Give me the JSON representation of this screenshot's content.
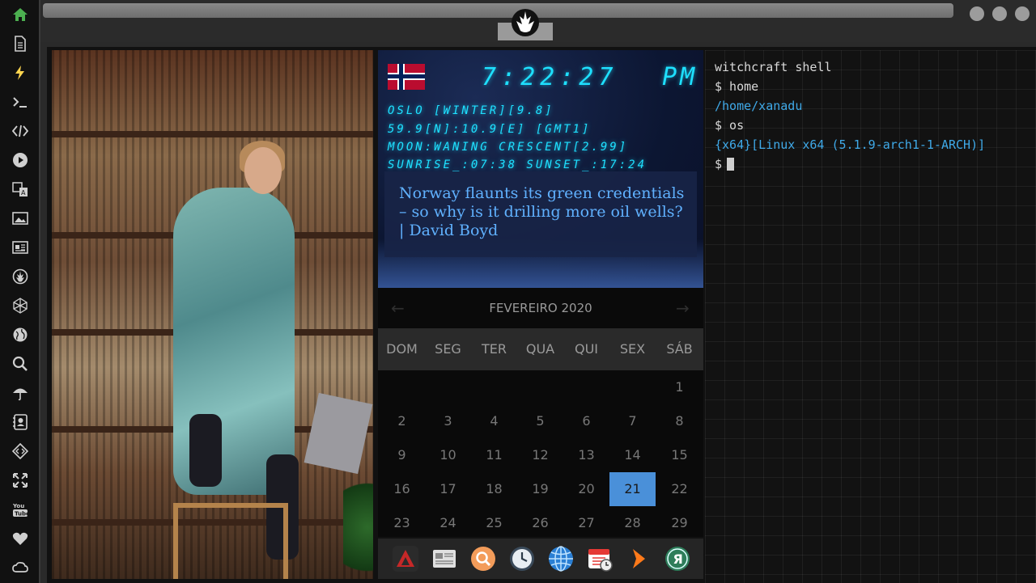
{
  "sidebar": {
    "items": [
      {
        "icon": "home-icon",
        "color": "#4caf50"
      },
      {
        "icon": "document-icon",
        "color": "#cfcfcf"
      },
      {
        "icon": "lightning-icon",
        "color": "#ffd54f"
      },
      {
        "icon": "terminal-icon",
        "color": "#cfcfcf"
      },
      {
        "icon": "code-icon",
        "color": "#cfcfcf"
      },
      {
        "icon": "play-icon",
        "color": "#cfcfcf"
      },
      {
        "icon": "translate-icon",
        "color": "#cfcfcf"
      },
      {
        "icon": "image-icon",
        "color": "#cfcfcf"
      },
      {
        "icon": "newspaper-icon",
        "color": "#cfcfcf"
      },
      {
        "icon": "rebel-icon",
        "color": "#cfcfcf"
      },
      {
        "icon": "polyhedron-icon",
        "color": "#cfcfcf"
      },
      {
        "icon": "globe-icon",
        "color": "#cfcfcf"
      },
      {
        "icon": "search-icon",
        "color": "#cfcfcf"
      },
      {
        "icon": "umbrella-icon",
        "color": "#cfcfcf"
      },
      {
        "icon": "contact-icon",
        "color": "#cfcfcf"
      },
      {
        "icon": "diamond-code-icon",
        "color": "#cfcfcf"
      },
      {
        "icon": "fullscreen-icon",
        "color": "#cfcfcf"
      },
      {
        "icon": "youtube-icon",
        "color": "#cfcfcf"
      },
      {
        "icon": "heart-icon",
        "color": "#cfcfcf"
      },
      {
        "icon": "cloud-icon",
        "color": "#cfcfcf"
      }
    ]
  },
  "window": {
    "logo_icon": "rebel-alliance-icon",
    "buttons": [
      "minimize-icon",
      "maximize-icon",
      "close-icon"
    ]
  },
  "clock": {
    "time": "7:22:27",
    "ampm": "PM",
    "flag": "norway-flag",
    "city_line": "OSLO [WINTER][9.8]",
    "coords_line": "59.9[N]:10.9[E] [GMT1]",
    "moon_line": "MOON:WANING CRESCENT[2.99]",
    "sun_line": "SUNRISE_:07:38 SUNSET_:17:24",
    "headline": "Norway flaunts its green credentials – so why is it drilling more oil wells? | David Boyd"
  },
  "calendar": {
    "month_label": "FEVEREIRO 2020",
    "prev_icon": "arrow-left-icon",
    "next_icon": "arrow-right-icon",
    "weekdays": [
      "DOM",
      "SEG",
      "TER",
      "QUA",
      "QUI",
      "SEX",
      "SÁB"
    ],
    "weeks": [
      [
        "",
        "",
        "",
        "",
        "",
        "",
        "1"
      ],
      [
        "2",
        "3",
        "4",
        "5",
        "6",
        "7",
        "8"
      ],
      [
        "9",
        "10",
        "11",
        "12",
        "13",
        "14",
        "15"
      ],
      [
        "16",
        "17",
        "18",
        "19",
        "20",
        "21",
        "22"
      ],
      [
        "23",
        "24",
        "25",
        "26",
        "27",
        "28",
        "29"
      ]
    ],
    "selected": "21",
    "accent": "#4a90d9"
  },
  "dock": {
    "apps": [
      {
        "icon": "arch-launcher-icon",
        "color": "#c62828"
      },
      {
        "icon": "newspaper-app-icon",
        "color": "#e0e0e0"
      },
      {
        "icon": "search-app-icon",
        "color": "#f39c5a"
      },
      {
        "icon": "clock-app-icon",
        "color": "#3a4a5a"
      },
      {
        "icon": "web-browser-icon",
        "color": "#2a7fd4"
      },
      {
        "icon": "calendar-app-icon",
        "color": "#e53935"
      },
      {
        "icon": "forward-arrow-icon",
        "color": "#ff7a1a"
      },
      {
        "icon": "yandex-icon",
        "color": "#2e7d5a"
      }
    ]
  },
  "terminal": {
    "lines": [
      {
        "text": "witchcraft shell",
        "kind": "prompt"
      },
      {
        "text": "$ home",
        "kind": "prompt"
      },
      {
        "text": "/home/xanadu",
        "kind": "out"
      },
      {
        "text": "$ os",
        "kind": "prompt"
      },
      {
        "text": "{x64}[Linux x64 (5.1.9-arch1-1-ARCH)]",
        "kind": "out"
      },
      {
        "text": "$",
        "kind": "prompt"
      }
    ]
  }
}
